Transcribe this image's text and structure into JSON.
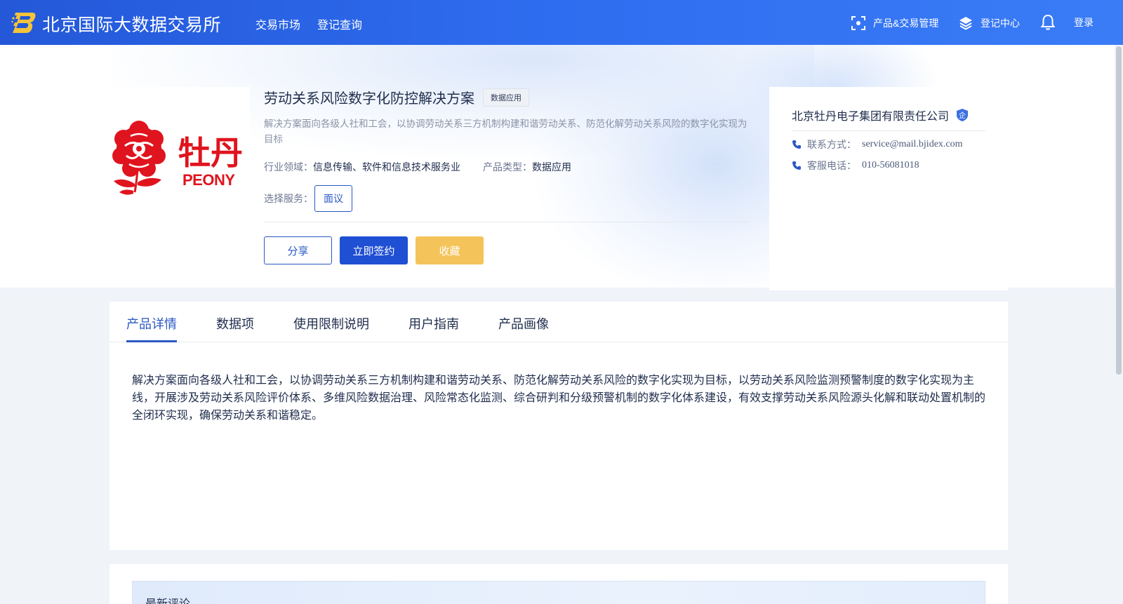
{
  "header": {
    "site_name": "北京国际大数据交易所",
    "nav": [
      "交易市场",
      "登记查询"
    ],
    "product_mgmt": "产品&交易管理",
    "registry_center": "登记中心",
    "login": "登录"
  },
  "product": {
    "title": "劳动关系风险数字化防控解决方案",
    "tag": "数据应用",
    "description": "解决方案面向各级人社和工会，以协调劳动关系三方机制构建和谐劳动关系、防范化解劳动关系风险的数字化实现为目标",
    "industry_label": "行业领域：",
    "industry_value": "信息传输、软件和信息技术服务业",
    "type_label": "产品类型：",
    "type_value": "数据应用",
    "service_label": "选择服务：",
    "service_option": "面议",
    "logo": {
      "brand_cn": "牡丹",
      "brand_en": "PEONY"
    },
    "buttons": {
      "share": "分享",
      "sign": "立即签约",
      "favorite": "收藏"
    }
  },
  "seller": {
    "name": "北京牡丹电子集团有限责任公司",
    "badge": "企",
    "contact_label": "联系方式：",
    "contact_value": "service@mail.bjidex.com",
    "phone_label": "客服电话：",
    "phone_value": "010-56081018"
  },
  "tabs": [
    "产品详情",
    "数据项",
    "使用限制说明",
    "用户指南",
    "产品画像"
  ],
  "active_tab": "产品详情",
  "detail_text": "解决方案面向各级人社和工会，以协调劳动关系三方机制构建和谐劳动关系、防范化解劳动关系风险的数字化实现为目标，以劳动关系风险监测预警制度的数字化实现为主线，开展涉及劳动关系风险评价体系、多维风险数据治理、风险常态化监测、综合研判和分级预警机制的数字化体系建设，有效支撑劳动关系风险源头化解和联动处置机制的全闭环实现，确保劳动关系和谐稳定。",
  "comments": {
    "title": "最新评论"
  },
  "colors": {
    "header_blue": "#2f6df0",
    "primary": "#1f4fd3",
    "favorite": "#f4c45b",
    "brand_red": "#e0141e"
  }
}
